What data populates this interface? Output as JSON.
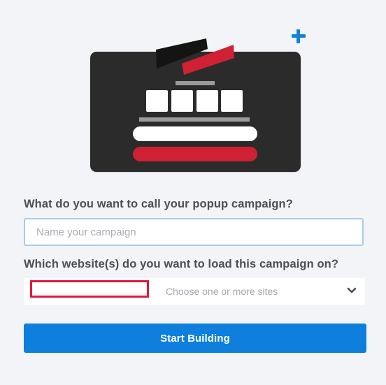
{
  "campaign_name": {
    "label": "What do you want to call your popup campaign?",
    "placeholder": "Name your campaign",
    "value": ""
  },
  "sites": {
    "label": "Which website(s) do you want to load this campaign on?",
    "placeholder": "Choose one or more sites",
    "selected_value": ""
  },
  "actions": {
    "start_label": "Start Building"
  },
  "icons": {
    "add": "plus-icon",
    "dropdown": "chevron-down-icon",
    "illustration": "popup-builder-illustration"
  },
  "colors": {
    "accent": "#0e7fdc",
    "plus": "#1182d9",
    "card": "#2b2b2c",
    "brand_red": "#cf2133",
    "highlight_border": "#e4163d",
    "input_border": "#a9cbeb",
    "background": "#f3f4f7"
  }
}
